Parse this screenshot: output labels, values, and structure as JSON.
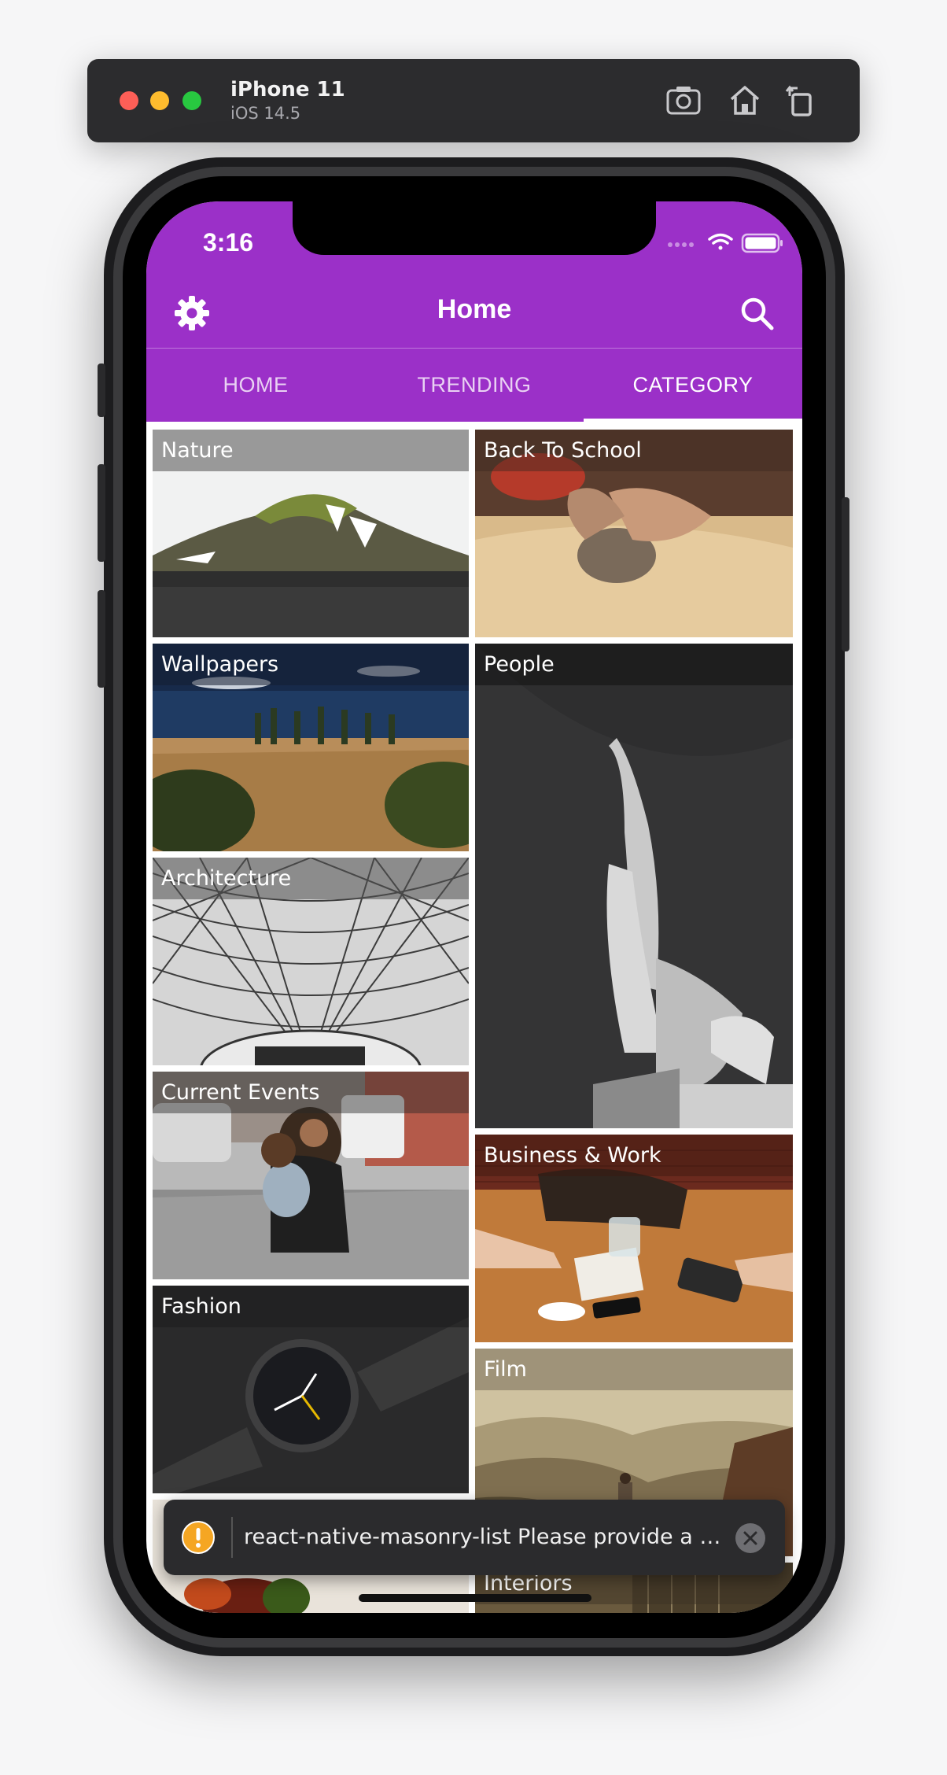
{
  "simulator": {
    "device_name": "iPhone 11",
    "os_version": "iOS 14.5",
    "buttons": [
      "screenshot-icon",
      "home-icon",
      "rotate-icon"
    ]
  },
  "status_bar": {
    "time": "3:16"
  },
  "header": {
    "title": "Home",
    "left_icon": "gear-icon",
    "right_icon": "search-icon",
    "background": "#9b30c8"
  },
  "tabs": [
    {
      "label": "HOME",
      "active": false
    },
    {
      "label": "TRENDING",
      "active": false
    },
    {
      "label": "CATEGORY",
      "active": true
    }
  ],
  "categories": [
    {
      "label": "Nature"
    },
    {
      "label": "Back To School"
    },
    {
      "label": "Wallpapers"
    },
    {
      "label": "People"
    },
    {
      "label": "Architecture"
    },
    {
      "label": "Current Events"
    },
    {
      "label": "Business & Work"
    },
    {
      "label": "Fashion"
    },
    {
      "label": "Film"
    },
    {
      "label": "Interiors"
    }
  ],
  "toast": {
    "message": "react-native-masonry-list Please provide a va...",
    "icon": "warning-icon",
    "close_icon": "close-icon"
  }
}
